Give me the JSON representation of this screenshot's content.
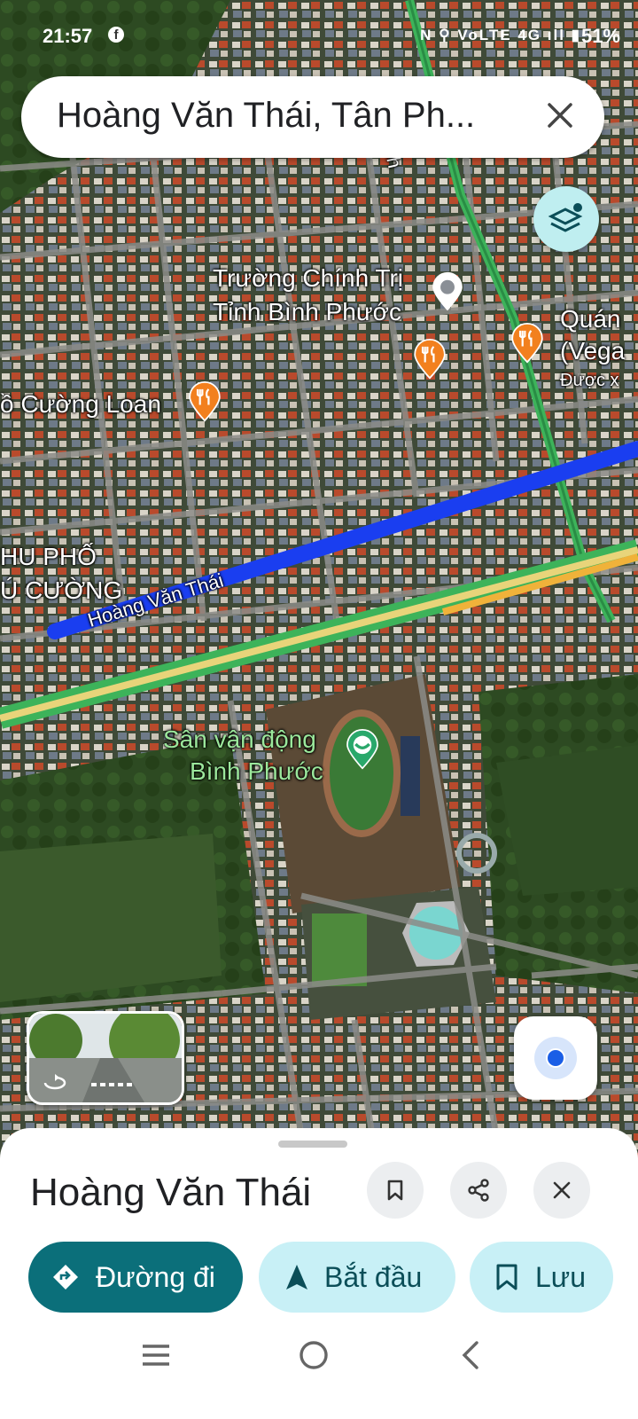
{
  "status_bar": {
    "time": "21:57",
    "facebook_icon": "facebook-icon",
    "indicators": "N ⚲ VoLTE 4G ıll ▮",
    "battery": "51%"
  },
  "search": {
    "query": "Hoàng Văn Thái, Tân Ph...",
    "clear_icon": "close-icon"
  },
  "map": {
    "labels": {
      "poi_school_line1": "Trường Chính Trị",
      "poi_school_line2": "Tỉnh Bình Phước",
      "poi_restaurant_left": "ồ Cường Loan",
      "poi_restaurant_right_line1": "Quán",
      "poi_restaurant_right_line2": "(Vega",
      "poi_restaurant_right_line3": "Được x",
      "district_line1": "HU PHỐ",
      "district_line2": "Ú CƯỜNG",
      "street": "Hoàng Văn Thái",
      "road_vertical": "Trư... inh",
      "stadium_line1": "Sân vận động",
      "stadium_line2": "Bình Phước"
    },
    "colors": {
      "route": "#1a3ef0",
      "highway": "#3db35a",
      "highway_center": "#e8d47a",
      "restaurant_pin": "#f2801e",
      "park_pin": "#2aa86b"
    }
  },
  "bottom_sheet": {
    "title": "Hoàng Văn Thái",
    "actions": {
      "directions": "Đường đi",
      "start": "Bắt đầu",
      "save": "Lưu"
    }
  }
}
